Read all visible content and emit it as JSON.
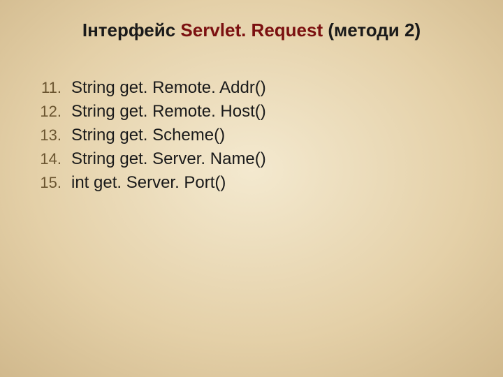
{
  "title": {
    "prefix": "Інтерфейс ",
    "klass": "Servlet. Request",
    "suffix": " (методи 2)"
  },
  "items": [
    {
      "num": "11.",
      "text": "String get. Remote. Addr()"
    },
    {
      "num": "12.",
      "text": "String get. Remote. Host()"
    },
    {
      "num": "13.",
      "text": "String get. Scheme()"
    },
    {
      "num": "14.",
      "text": "String get. Server. Name()"
    },
    {
      "num": "15.",
      "text": "int get. Server. Port()"
    }
  ]
}
